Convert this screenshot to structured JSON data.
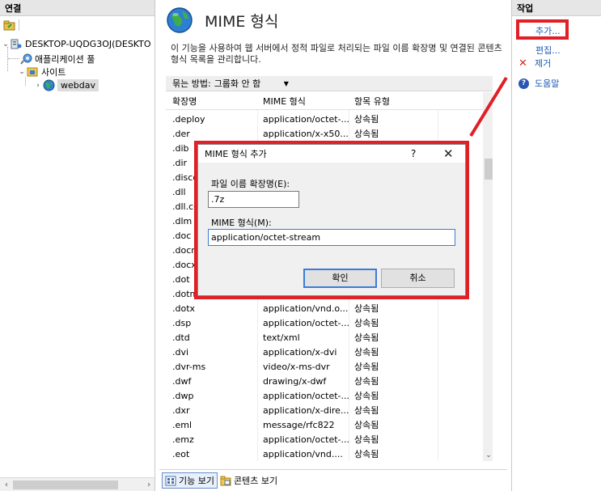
{
  "left_pane": {
    "header": "연결",
    "tree": [
      {
        "label": "DESKTOP-UQDG3OJ(DESKTO",
        "icon": "server-icon",
        "level": 0,
        "expanded": true
      },
      {
        "label": "애플리케이션 풀",
        "icon": "app-pool-icon",
        "level": 1
      },
      {
        "label": "사이트",
        "icon": "sites-folder-icon",
        "level": 1,
        "expanded": true
      },
      {
        "label": "webdav",
        "icon": "globe-icon",
        "level": 2,
        "selected": true
      }
    ]
  },
  "content": {
    "title": "MIME 형식",
    "description": "이 기능을 사용하여 웹 서버에서 정적 파일로 처리되는 파일 이름 확장명 및 연결된 콘텐츠 형식 목록을 관리합니다.",
    "group_by_label": "묶는 방법:",
    "group_by_value": "그룹화 안 함",
    "columns": [
      "확장명",
      "MIME 형식",
      "항목 유형"
    ],
    "rows": [
      {
        "ext": ".deploy",
        "mime": "application/octet-...",
        "type": "상속됨"
      },
      {
        "ext": ".der",
        "mime": "application/x-x50...",
        "type": "상속됨"
      },
      {
        "ext": ".dib",
        "mime": "",
        "type": ""
      },
      {
        "ext": ".dir",
        "mime": "",
        "type": ""
      },
      {
        "ext": ".disco",
        "mime": "",
        "type": ""
      },
      {
        "ext": ".dll",
        "mime": "",
        "type": ""
      },
      {
        "ext": ".dll.co",
        "mime": "",
        "type": ""
      },
      {
        "ext": ".dlm",
        "mime": "",
        "type": ""
      },
      {
        "ext": ".doc",
        "mime": "",
        "type": ""
      },
      {
        "ext": ".docm",
        "mime": "",
        "type": ""
      },
      {
        "ext": ".docx",
        "mime": "",
        "type": ""
      },
      {
        "ext": ".dot",
        "mime": "",
        "type": ""
      },
      {
        "ext": ".dotm",
        "mime": "",
        "type": ""
      },
      {
        "ext": ".dotx",
        "mime": "application/vnd.o...",
        "type": "상속됨"
      },
      {
        "ext": ".dsp",
        "mime": "application/octet-...",
        "type": "상속됨"
      },
      {
        "ext": ".dtd",
        "mime": "text/xml",
        "type": "상속됨"
      },
      {
        "ext": ".dvi",
        "mime": "application/x-dvi",
        "type": "상속됨"
      },
      {
        "ext": ".dvr-ms",
        "mime": "video/x-ms-dvr",
        "type": "상속됨"
      },
      {
        "ext": ".dwf",
        "mime": "drawing/x-dwf",
        "type": "상속됨"
      },
      {
        "ext": ".dwp",
        "mime": "application/octet-...",
        "type": "상속됨"
      },
      {
        "ext": ".dxr",
        "mime": "application/x-dire...",
        "type": "상속됨"
      },
      {
        "ext": ".eml",
        "mime": "message/rfc822",
        "type": "상속됨"
      },
      {
        "ext": ".emz",
        "mime": "application/octet-...",
        "type": "상속됨"
      },
      {
        "ext": ".eot",
        "mime": "application/vnd....",
        "type": "상속됨"
      }
    ],
    "tabs": [
      "기능 보기",
      "콘텐츠 보기"
    ]
  },
  "actions": {
    "header": "작업",
    "add": "추가...",
    "edit": "편집...",
    "remove": "제거",
    "help": "도움말"
  },
  "dialog": {
    "title": "MIME 형식 추가",
    "help_glyph": "?",
    "close_glyph": "✕",
    "ext_label": "파일 이름 확장명(E):",
    "ext_value": ".7z",
    "mime_label": "MIME 형식(M):",
    "mime_value": "application/octet-stream",
    "ok": "확인",
    "cancel": "취소"
  },
  "colors": {
    "annotation_red": "#e01f26",
    "link_blue": "#1b5bb5",
    "focus_blue": "#3b7cdb"
  }
}
